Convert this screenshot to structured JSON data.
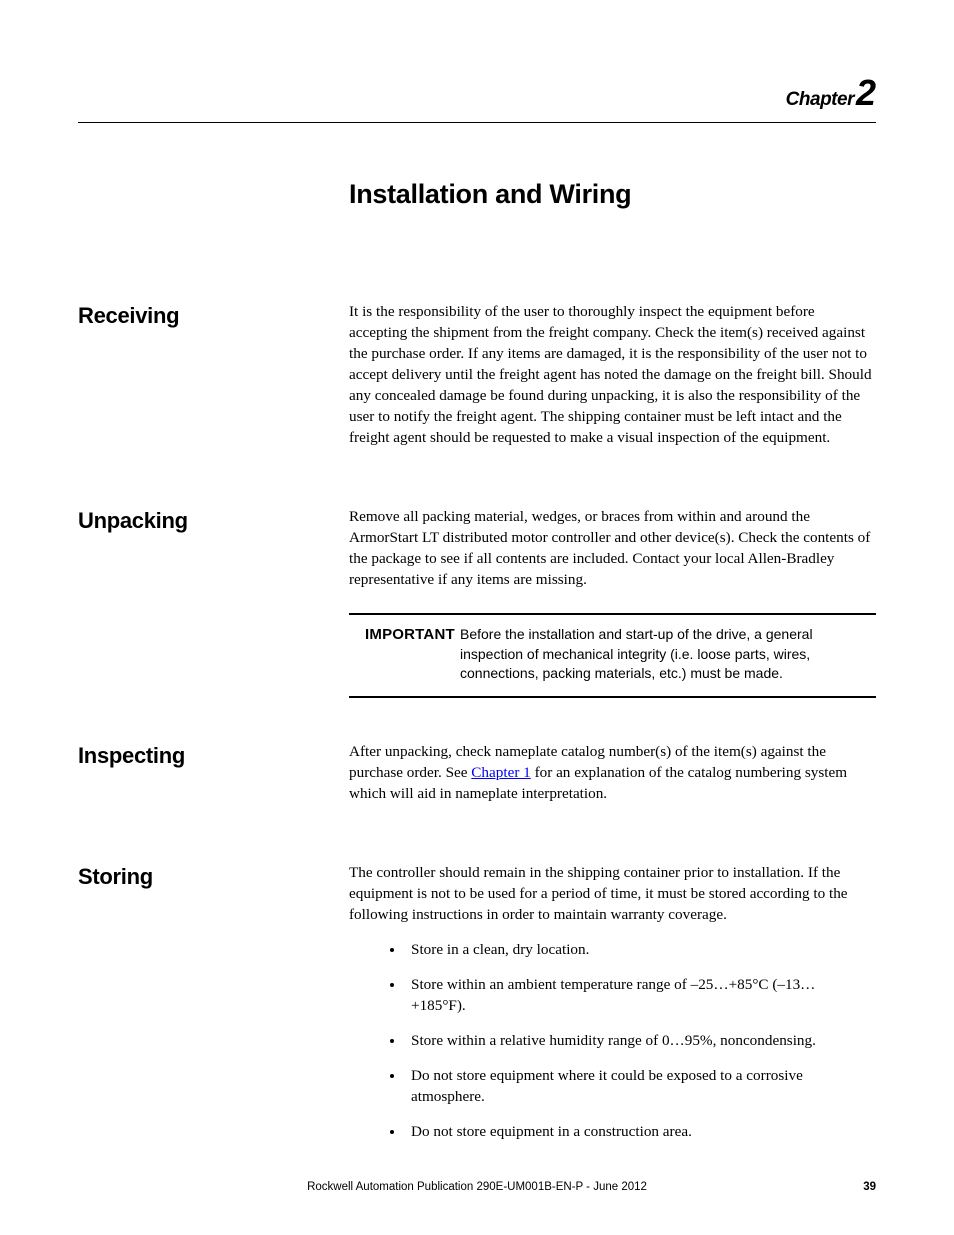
{
  "chapter": {
    "label": "Chapter",
    "number": "2",
    "title": "Installation and Wiring"
  },
  "sections": {
    "receiving": {
      "heading": "Receiving",
      "body": "It is the responsibility of the user to thoroughly inspect the equipment before accepting the shipment from the freight company. Check the item(s) received against the purchase order. If any items are damaged, it is the responsibility of the user not to accept delivery until the freight agent has noted the damage on the freight bill. Should any concealed damage be found during unpacking, it is also the responsibility of the user to notify the freight agent. The shipping container must be left intact and the freight agent should be requested to make a visual inspection of the equipment."
    },
    "unpacking": {
      "heading": "Unpacking",
      "body": "Remove all packing material, wedges, or braces from within and around the ArmorStart LT distributed motor controller and other device(s). Check the contents of the package to see if all contents are included. Contact your local Allen-Bradley representative if any items are missing.",
      "important_label": "IMPORTANT",
      "important_text": "Before the installation and start-up of the drive, a general inspection of mechanical integrity (i.e. loose parts, wires, connections, packing materials, etc.) must be made."
    },
    "inspecting": {
      "heading": "Inspecting",
      "body_pre": "After unpacking, check nameplate catalog number(s) of the item(s) against the purchase order. See ",
      "link_text": "Chapter 1",
      "body_post": " for an explanation of the catalog numbering system which will aid in nameplate interpretation."
    },
    "storing": {
      "heading": "Storing",
      "body": "The controller should remain in the shipping container prior to installation. If the equipment is not to be used for a period of time, it must be stored according to the following instructions in order to maintain warranty coverage.",
      "bullets": [
        "Store in a clean, dry location.",
        "Store within an ambient temperature range of –25…+85°C (–13…+185°F).",
        "Store within a relative humidity range of 0…95%, noncondensing.",
        "Do not store equipment where it could be exposed to a corrosive atmosphere.",
        "Do not store equipment in a construction area."
      ]
    }
  },
  "footer": {
    "publication": "Rockwell Automation Publication 290E-UM001B-EN-P - June 2012",
    "page": "39"
  }
}
